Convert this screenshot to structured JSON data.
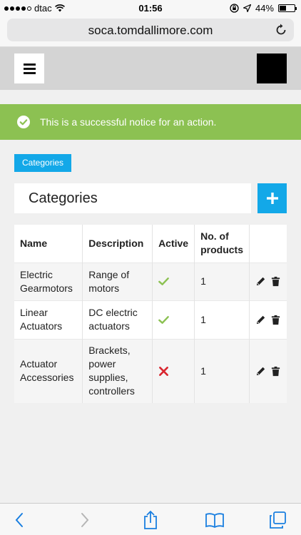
{
  "status_bar": {
    "carrier": "dtac",
    "time": "01:56",
    "battery": "44%"
  },
  "browser": {
    "url": "soca.tomdallimore.com"
  },
  "notice": {
    "text": "This is a successful notice for an action.",
    "color": "#8cc152"
  },
  "breadcrumb": {
    "label": "Categories"
  },
  "page": {
    "title": "Categories",
    "add_button_label": "+"
  },
  "table": {
    "headers": {
      "name": "Name",
      "description": "Description",
      "active": "Active",
      "count": "No. of products"
    },
    "rows": [
      {
        "name": "Electric Gearmotors",
        "description": "Range of motors",
        "active": true,
        "count": "1"
      },
      {
        "name": "Linear Actuators",
        "description": "DC electric actuators",
        "active": true,
        "count": "1"
      },
      {
        "name": "Actuator Accessories",
        "description": "Brackets, power supplies, controllers",
        "active": false,
        "count": "1"
      }
    ]
  },
  "colors": {
    "accent": "#13a8e8",
    "success": "#8cc152",
    "active_check": "#8cc152",
    "inactive_x": "#d9262f"
  },
  "icons": [
    "hamburger-icon",
    "success-check-icon",
    "plus-icon",
    "check-icon",
    "cross-icon",
    "pencil-icon",
    "trash-icon",
    "back-icon",
    "forward-icon",
    "share-icon",
    "bookmarks-icon",
    "tabs-icon",
    "reload-icon"
  ]
}
